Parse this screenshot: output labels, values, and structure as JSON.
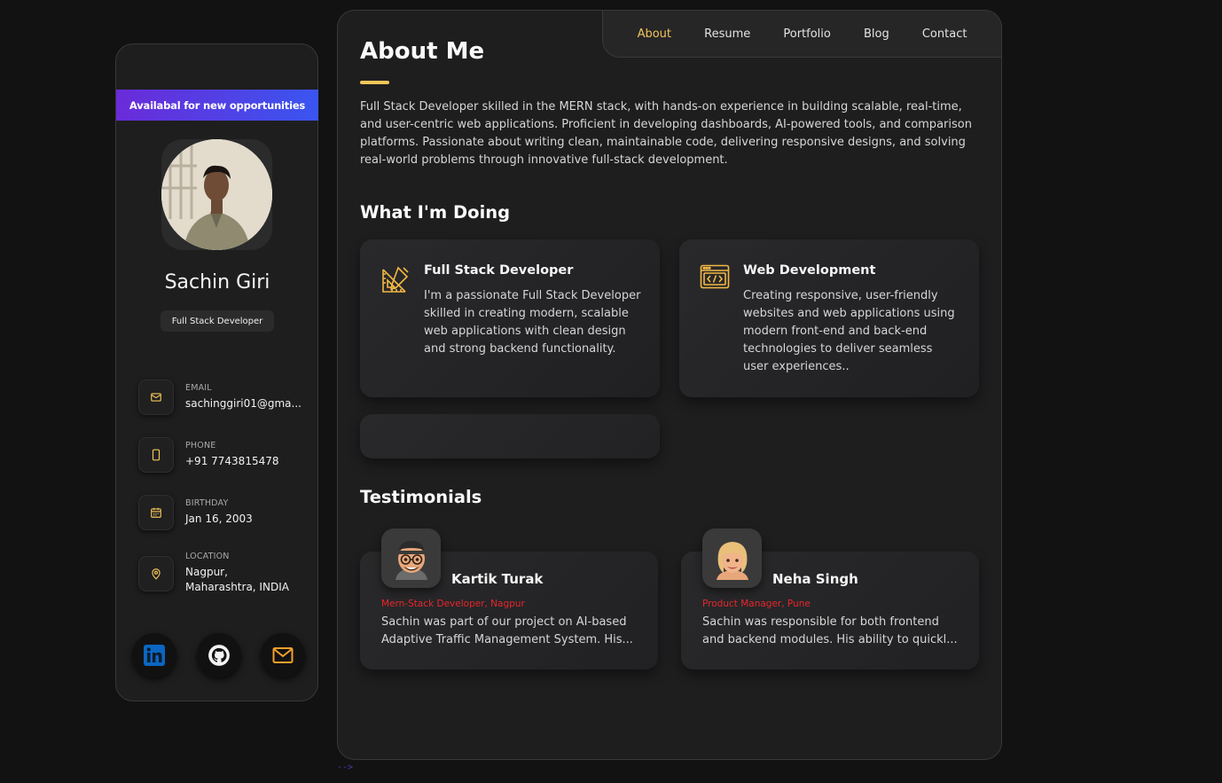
{
  "sidebar": {
    "banner": "Availabal for new opportunities",
    "name": "Sachin Giri",
    "role": "Full Stack Developer",
    "contacts": [
      {
        "label": "EMAIL",
        "value": "sachinggiri01@gma...",
        "icon": "mail-icon"
      },
      {
        "label": "PHONE",
        "value": "+91 7743815478",
        "icon": "phone-icon"
      },
      {
        "label": "BIRTHDAY",
        "value": "Jan 16, 2003",
        "icon": "calendar-icon"
      },
      {
        "label": "LOCATION",
        "value": "Nagpur, Maharashtra, INDIA",
        "icon": "location-icon"
      }
    ],
    "socials": [
      {
        "name": "linkedin-icon"
      },
      {
        "name": "github-icon"
      },
      {
        "name": "mail-icon"
      }
    ]
  },
  "nav": {
    "items": [
      {
        "label": "About",
        "active": true
      },
      {
        "label": "Resume",
        "active": false
      },
      {
        "label": "Portfolio",
        "active": false
      },
      {
        "label": "Blog",
        "active": false
      },
      {
        "label": "Contact",
        "active": false
      }
    ]
  },
  "about": {
    "title": "About Me",
    "text": "Full Stack Developer skilled in the MERN stack, with hands-on experience in building scalable, real-time, and user-centric web applications. Proficient in developing dashboards, AI-powered tools, and comparison platforms. Passionate about writing clean, maintainable code, delivering responsive designs, and solving real-world problems through innovative full-stack development."
  },
  "services": {
    "title": "What I'm Doing",
    "items": [
      {
        "title": "Full Stack Developer",
        "text": "I'm a passionate Full Stack Developer skilled in creating modern, scalable web applications with clean design and strong backend functionality.",
        "icon": "design-tools-icon"
      },
      {
        "title": "Web Development",
        "text": "Creating responsive, user-friendly websites and web applications using modern front-end and back-end technologies to deliver seamless user experiences..",
        "icon": "code-window-icon"
      }
    ]
  },
  "testimonials": {
    "title": "Testimonials",
    "items": [
      {
        "name": "Kartik Turak",
        "role": "Mern-Stack Developer, Nagpur",
        "text": "Sachin was part of our project on AI-based Adaptive Traffic Management System. His..."
      },
      {
        "name": "Neha Singh",
        "role": "Product Manager, Pune",
        "text": "Sachin was responsible for both frontend and backend modules. His ability to quickl..."
      }
    ]
  },
  "footer": {
    "stray_text": "-->"
  },
  "colors": {
    "accent": "#f3c55a",
    "testimonial_role": "#e8262b",
    "banner_start": "#6a2bd9",
    "banner_end": "#3a55f0"
  }
}
